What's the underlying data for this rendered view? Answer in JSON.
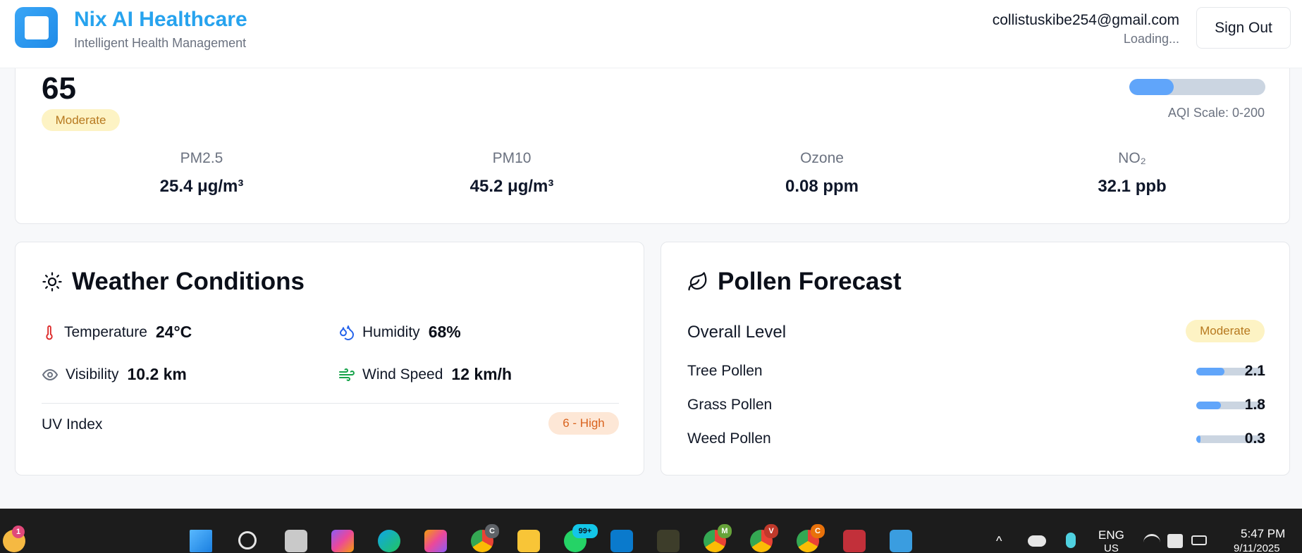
{
  "header": {
    "app_name": "Nix AI Healthcare",
    "tagline": "Intelligent Health Management",
    "user_email": "collistuskibe254@gmail.com",
    "user_status": "Loading...",
    "signout_label": "Sign Out"
  },
  "aqi": {
    "value": "65",
    "level": "Moderate",
    "level_color": "#b7791f",
    "bar_fraction": 0.325,
    "scale_label": "AQI Scale: 0-200",
    "metrics": [
      {
        "label": "PM2.5",
        "value": "25.4 μg/m³"
      },
      {
        "label": "PM10",
        "value": "45.2 μg/m³"
      },
      {
        "label": "Ozone",
        "value": "0.08 ppm"
      },
      {
        "label": "NO₂",
        "value": "32.1 ppb"
      }
    ]
  },
  "weather": {
    "title": "Weather Conditions",
    "title_icon": "sun-icon",
    "temperature": {
      "label": "Temperature",
      "value": "24°C",
      "icon": "thermometer-icon",
      "color": "#dc2626"
    },
    "humidity": {
      "label": "Humidity",
      "value": "68%",
      "icon": "droplets-icon",
      "color": "#2563eb"
    },
    "visibility": {
      "label": "Visibility",
      "value": "10.2 km",
      "icon": "eye-icon",
      "color": "#6b7280"
    },
    "wind": {
      "label": "Wind Speed",
      "value": "12 km/h",
      "icon": "wind-icon",
      "color": "#16a34a"
    },
    "uv_label": "UV Index",
    "uv_value": "6 - High",
    "uv_color": "#d9631e"
  },
  "pollen": {
    "title": "Pollen Forecast",
    "title_icon": "leaf-icon",
    "overall_label": "Overall Level",
    "overall_value": "Moderate",
    "items": [
      {
        "label": "Tree Pollen",
        "value": "2.1",
        "fraction": 0.42
      },
      {
        "label": "Grass Pollen",
        "value": "1.8",
        "fraction": 0.36
      },
      {
        "label": "Weed Pollen",
        "value": "0.3",
        "fraction": 0.06
      }
    ]
  },
  "taskbar": {
    "weather_badge": "1",
    "whatsapp_badge": "99+",
    "chrome_profile_1": "C",
    "chrome_profile_2": "M",
    "chrome_profile_3": "V",
    "chrome_profile_4": "C",
    "language": "ENG",
    "region": "US",
    "time": "5:47 PM",
    "date": "9/11/2025"
  }
}
